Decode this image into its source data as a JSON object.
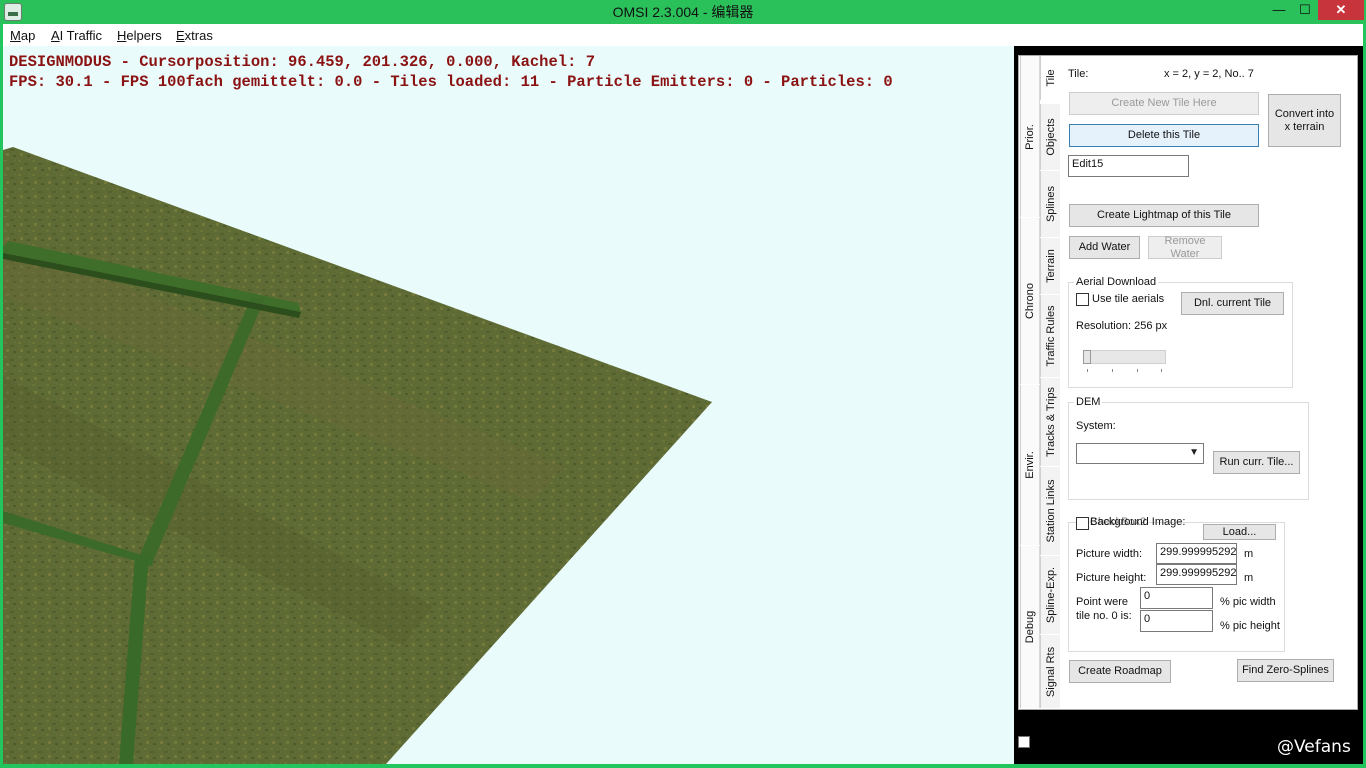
{
  "window": {
    "title": "OMSI 2.3.004 - 编辑器",
    "minimize": "—",
    "maximize": "☐",
    "close": "✕"
  },
  "menu": {
    "items": [
      {
        "label": "Map",
        "accel": "M",
        "rest": "ap"
      },
      {
        "label": "AI Traffic",
        "accel": "A",
        "rest": "I Traffic"
      },
      {
        "label": "Helpers",
        "accel": "H",
        "rest": "elpers"
      },
      {
        "label": "Extras",
        "accel": "E",
        "rest": "xtras"
      }
    ]
  },
  "viewport": {
    "status_line_1": "DESIGNMODUS - Cursorposition: 96.459, 201.326, 0.000, Kachel: 7",
    "status_line_2": "FPS: 30.1 - FPS 100fach gemittelt: 0.0 - Tiles loaded: 11 - Particle Emitters: 0 - Particles: 0",
    "colors": {
      "sky": "#e9fbfb",
      "terrain": "#5e6a33",
      "hedge": "#3f6e2a",
      "status_text": "#8b1212"
    }
  },
  "tabs": {
    "inner": [
      "Tile",
      "Objects",
      "Splines",
      "Terrain",
      "Traffic Rules",
      "Tracks & Trips",
      "Station Links",
      "Spline-Exp.",
      "Signal Rts"
    ],
    "outer": [
      "Prior.",
      "Chrono",
      "Envir.",
      "Debug"
    ],
    "active": "Tile"
  },
  "tile": {
    "label": "Tile:",
    "info": "x = 2, y = 2, No.. 7",
    "create_new_tile": "Create New Tile Here",
    "delete_tile": "Delete this Tile",
    "convert_terrain": "Convert into x terrain",
    "edit_value": "Edit15",
    "create_lightmap": "Create Lightmap of this Tile",
    "add_water": "Add Water",
    "remove_water": "Remove Water"
  },
  "aerial": {
    "title": "Aerial Download",
    "use_tile_aerials": "Use tile aerials",
    "use_tile_aerials_checked": false,
    "dnl_current_tile": "Dnl. current Tile",
    "resolution": "Resolution: 256 px",
    "slider_level": 0
  },
  "dem": {
    "title": "DEM",
    "system_label": "System:",
    "system_value": "",
    "run_tile": "Run curr. Tile..."
  },
  "background": {
    "checkbox_label": "CheckBox2",
    "title": "Background Image:",
    "checked": false,
    "load": "Load...",
    "picture_width_label": "Picture width:",
    "picture_width": "299.999995292",
    "picture_height_label": "Picture height:",
    "picture_height": "299.999995292",
    "unit": "m",
    "point_label_1": "Point were",
    "point_label_2": "tile no. 0 is:",
    "pic_width_value": "0",
    "pic_height_value": "0",
    "pic_width_unit": "% pic width",
    "pic_height_unit": "% pic height"
  },
  "footer": {
    "create_roadmap": "Create Roadmap",
    "find_zero_splines": "Find Zero-Splines"
  },
  "watermark": "@Vefans"
}
